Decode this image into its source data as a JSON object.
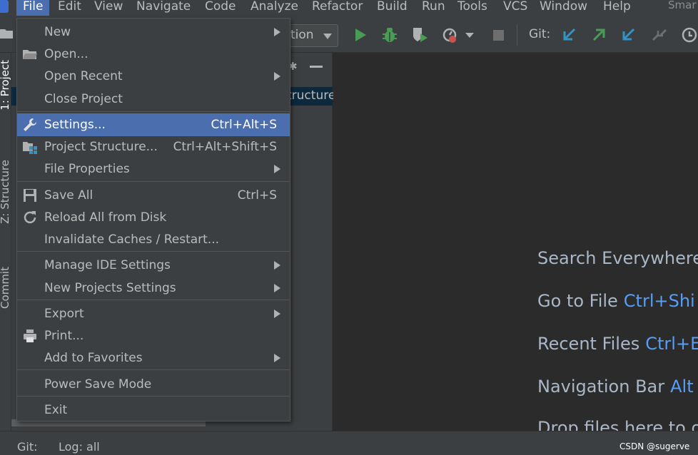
{
  "menubar": {
    "items": [
      "File",
      "Edit",
      "View",
      "Navigate",
      "Code",
      "Analyze",
      "Refactor",
      "Build",
      "Run",
      "Tools",
      "VCS",
      "Window",
      "Help"
    ],
    "title": "Smar"
  },
  "toolbar": {
    "run_config": "tion",
    "git_label": "Git:"
  },
  "left_strip": {
    "tabs": [
      "1: Project",
      "Z: Structure",
      "Commit"
    ]
  },
  "project_panel": {
    "selected_node": "tructure"
  },
  "file_menu": {
    "items": [
      {
        "label": "New",
        "submenu": true,
        "icon": "none"
      },
      {
        "label": "Open...",
        "icon": "folder-icon"
      },
      {
        "label": "Open Recent",
        "submenu": true,
        "icon": "none"
      },
      {
        "label": "Close Project",
        "icon": "none"
      },
      {
        "label": "Settings...",
        "shortcut": "Ctrl+Alt+S",
        "icon": "wrench-icon",
        "selected": true
      },
      {
        "label": "Project Structure...",
        "shortcut": "Ctrl+Alt+Shift+S",
        "icon": "project-structure-icon"
      },
      {
        "label": "File Properties",
        "submenu": true,
        "icon": "none"
      },
      {
        "label": "Save All",
        "shortcut": "Ctrl+S",
        "icon": "save-icon"
      },
      {
        "label": "Reload All from Disk",
        "icon": "reload-icon"
      },
      {
        "label": "Invalidate Caches / Restart...",
        "icon": "none"
      },
      {
        "label": "Manage IDE Settings",
        "submenu": true,
        "icon": "none"
      },
      {
        "label": "New Projects Settings",
        "submenu": true,
        "icon": "none"
      },
      {
        "label": "Export",
        "submenu": true,
        "icon": "none"
      },
      {
        "label": "Print...",
        "icon": "printer-icon"
      },
      {
        "label": "Add to Favorites",
        "submenu": true,
        "icon": "none"
      },
      {
        "label": "Power Save Mode",
        "icon": "none"
      },
      {
        "label": "Exit",
        "icon": "none"
      }
    ]
  },
  "editor": {
    "hints": [
      {
        "label": "Search Everywhere",
        "shortcut": ""
      },
      {
        "label": "Go to File",
        "shortcut": "Ctrl+Shi"
      },
      {
        "label": "Recent Files",
        "shortcut": "Ctrl+E"
      },
      {
        "label": "Navigation Bar",
        "shortcut": "Alt"
      },
      {
        "label": "Drop files here to o",
        "shortcut": ""
      }
    ]
  },
  "statusbar": {
    "git": "Git:",
    "log": "Log: all"
  },
  "watermark": "CSDN @sugerve",
  "colors": {
    "menu_bg": "#3c3f41",
    "selection": "#4b6eaf",
    "shortcut_blue": "#589df6",
    "run_green": "#499c54",
    "git_blue": "#3592c4",
    "git_green": "#499c54"
  }
}
